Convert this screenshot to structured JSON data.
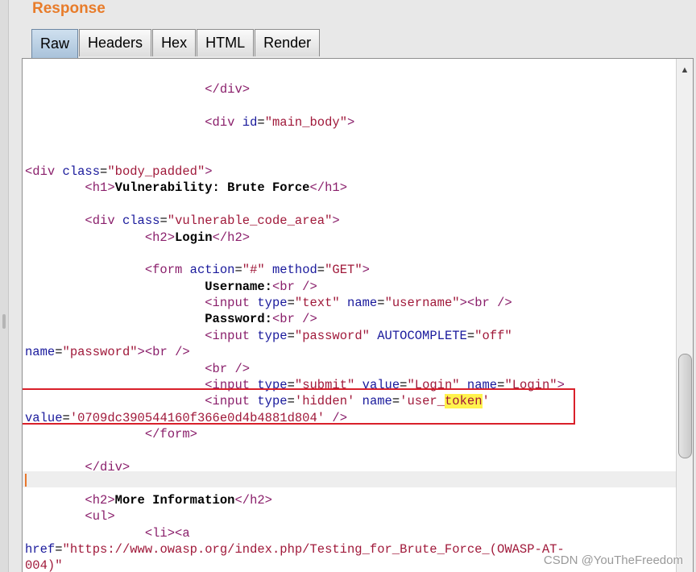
{
  "panel": {
    "title": "Response"
  },
  "tabs": [
    {
      "label": "Raw",
      "active": true
    },
    {
      "label": "Headers",
      "active": false
    },
    {
      "label": "Hex",
      "active": false
    },
    {
      "label": "HTML",
      "active": false
    },
    {
      "label": "Render",
      "active": false
    }
  ],
  "code_lines": [
    [
      {
        "t": "                        ",
        "c": "pl"
      },
      {
        "t": "</div>",
        "c": "tg"
      }
    ],
    [],
    [
      {
        "t": "                        ",
        "c": "pl"
      },
      {
        "t": "<div ",
        "c": "tg"
      },
      {
        "t": "id",
        "c": "at"
      },
      {
        "t": "=",
        "c": "pl"
      },
      {
        "t": "\"main_body\"",
        "c": "vl"
      },
      {
        "t": ">",
        "c": "tg"
      }
    ],
    [],
    [],
    [
      {
        "t": "<div ",
        "c": "tg"
      },
      {
        "t": "class",
        "c": "at"
      },
      {
        "t": "=",
        "c": "pl"
      },
      {
        "t": "\"body_padded\"",
        "c": "vl"
      },
      {
        "t": ">",
        "c": "tg"
      }
    ],
    [
      {
        "t": "        ",
        "c": "pl"
      },
      {
        "t": "<h1>",
        "c": "tg"
      },
      {
        "t": "Vulnerability: Brute Force",
        "c": "tx"
      },
      {
        "t": "</h1>",
        "c": "tg"
      }
    ],
    [],
    [
      {
        "t": "        ",
        "c": "pl"
      },
      {
        "t": "<div ",
        "c": "tg"
      },
      {
        "t": "class",
        "c": "at"
      },
      {
        "t": "=",
        "c": "pl"
      },
      {
        "t": "\"vulnerable_code_area\"",
        "c": "vl"
      },
      {
        "t": ">",
        "c": "tg"
      }
    ],
    [
      {
        "t": "                ",
        "c": "pl"
      },
      {
        "t": "<h2>",
        "c": "tg"
      },
      {
        "t": "Login",
        "c": "tx"
      },
      {
        "t": "</h2>",
        "c": "tg"
      }
    ],
    [],
    [
      {
        "t": "                ",
        "c": "pl"
      },
      {
        "t": "<form ",
        "c": "tg"
      },
      {
        "t": "action",
        "c": "at"
      },
      {
        "t": "=",
        "c": "pl"
      },
      {
        "t": "\"#\"",
        "c": "vl"
      },
      {
        "t": " ",
        "c": "pl"
      },
      {
        "t": "method",
        "c": "at"
      },
      {
        "t": "=",
        "c": "pl"
      },
      {
        "t": "\"GET\"",
        "c": "vl"
      },
      {
        "t": ">",
        "c": "tg"
      }
    ],
    [
      {
        "t": "                        ",
        "c": "pl"
      },
      {
        "t": "Username:",
        "c": "tx"
      },
      {
        "t": "<br />",
        "c": "tg"
      }
    ],
    [
      {
        "t": "                        ",
        "c": "pl"
      },
      {
        "t": "<input ",
        "c": "tg"
      },
      {
        "t": "type",
        "c": "at"
      },
      {
        "t": "=",
        "c": "pl"
      },
      {
        "t": "\"text\"",
        "c": "vl"
      },
      {
        "t": " ",
        "c": "pl"
      },
      {
        "t": "name",
        "c": "at"
      },
      {
        "t": "=",
        "c": "pl"
      },
      {
        "t": "\"username\"",
        "c": "vl"
      },
      {
        "t": ">",
        "c": "tg"
      },
      {
        "t": "<br />",
        "c": "tg"
      }
    ],
    [
      {
        "t": "                        ",
        "c": "pl"
      },
      {
        "t": "Password:",
        "c": "tx"
      },
      {
        "t": "<br />",
        "c": "tg"
      }
    ],
    [
      {
        "t": "                        ",
        "c": "pl"
      },
      {
        "t": "<input ",
        "c": "tg"
      },
      {
        "t": "type",
        "c": "at"
      },
      {
        "t": "=",
        "c": "pl"
      },
      {
        "t": "\"password\"",
        "c": "vl"
      },
      {
        "t": " ",
        "c": "pl"
      },
      {
        "t": "AUTOCOMPLETE",
        "c": "at"
      },
      {
        "t": "=",
        "c": "pl"
      },
      {
        "t": "\"off\"",
        "c": "vl"
      }
    ],
    [
      {
        "t": "name",
        "c": "at"
      },
      {
        "t": "=",
        "c": "pl"
      },
      {
        "t": "\"password\"",
        "c": "vl"
      },
      {
        "t": ">",
        "c": "tg"
      },
      {
        "t": "<br />",
        "c": "tg"
      }
    ],
    [
      {
        "t": "                        ",
        "c": "pl"
      },
      {
        "t": "<br />",
        "c": "tg"
      }
    ],
    [
      {
        "t": "                        ",
        "c": "pl"
      },
      {
        "t": "<input ",
        "c": "tg"
      },
      {
        "t": "type",
        "c": "at"
      },
      {
        "t": "=",
        "c": "pl"
      },
      {
        "t": "\"submit\"",
        "c": "vl"
      },
      {
        "t": " ",
        "c": "pl"
      },
      {
        "t": "value",
        "c": "at"
      },
      {
        "t": "=",
        "c": "pl"
      },
      {
        "t": "\"Login\"",
        "c": "vl"
      },
      {
        "t": " ",
        "c": "pl"
      },
      {
        "t": "name",
        "c": "at"
      },
      {
        "t": "=",
        "c": "pl"
      },
      {
        "t": "\"Login\"",
        "c": "vl"
      },
      {
        "t": ">",
        "c": "tg"
      }
    ],
    [
      {
        "t": "                        ",
        "c": "pl"
      },
      {
        "t": "<input ",
        "c": "tg"
      },
      {
        "t": "type",
        "c": "at"
      },
      {
        "t": "=",
        "c": "pl"
      },
      {
        "t": "'hidden'",
        "c": "vl"
      },
      {
        "t": " ",
        "c": "pl"
      },
      {
        "t": "name",
        "c": "at"
      },
      {
        "t": "=",
        "c": "pl"
      },
      {
        "t": "'user_",
        "c": "vl"
      },
      {
        "t": "token",
        "c": "vl hl"
      },
      {
        "t": "'",
        "c": "vl"
      }
    ],
    [
      {
        "t": "value",
        "c": "at"
      },
      {
        "t": "=",
        "c": "pl"
      },
      {
        "t": "'0709dc390544160f366e0d4b4881d804'",
        "c": "vl"
      },
      {
        "t": " />",
        "c": "tg"
      }
    ],
    [
      {
        "t": "                ",
        "c": "pl"
      },
      {
        "t": "</form>",
        "c": "tg"
      }
    ],
    [],
    [
      {
        "t": "        ",
        "c": "pl"
      },
      {
        "t": "</div>",
        "c": "tg"
      }
    ],
    [],
    [
      {
        "t": "        ",
        "c": "pl"
      },
      {
        "t": "<h2>",
        "c": "tg"
      },
      {
        "t": "More Information",
        "c": "tx"
      },
      {
        "t": "</h2>",
        "c": "tg"
      }
    ],
    [
      {
        "t": "        ",
        "c": "pl"
      },
      {
        "t": "<ul>",
        "c": "tg"
      }
    ],
    [
      {
        "t": "                ",
        "c": "pl"
      },
      {
        "t": "<li>",
        "c": "tg"
      },
      {
        "t": "<a",
        "c": "tg"
      }
    ],
    [
      {
        "t": "href",
        "c": "at"
      },
      {
        "t": "=",
        "c": "pl"
      },
      {
        "t": "\"https://www.owasp.org/index.php/Testing_for_Brute_Force_(OWASP-AT-",
        "c": "vl"
      }
    ],
    [
      {
        "t": "004)\"",
        "c": "vl"
      }
    ]
  ],
  "scroll_up_glyph": "▲",
  "watermark": "CSDN @YouTheFreedom"
}
